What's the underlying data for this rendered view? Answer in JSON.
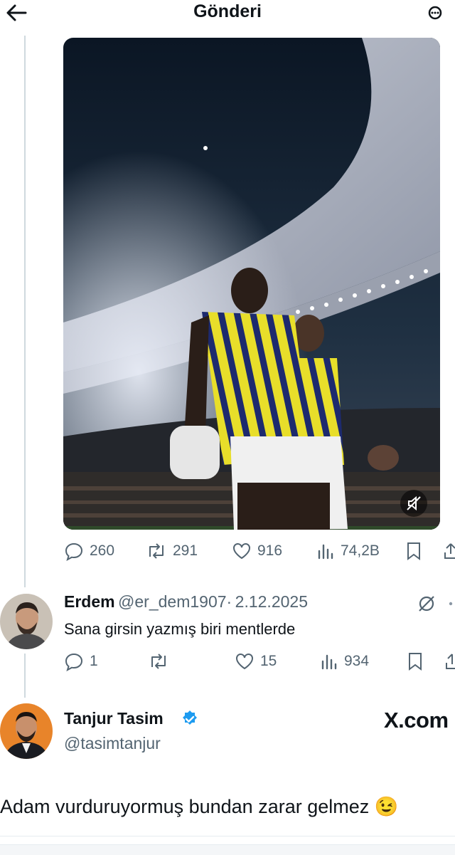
{
  "header": {
    "title": "Gönderi"
  },
  "original_tweet": {
    "actions": {
      "replies": "260",
      "retweets": "291",
      "likes": "916",
      "views": "74,2B"
    }
  },
  "reply": {
    "author_name": "Erdem",
    "author_handle": "@er_dem1907",
    "separator": "·",
    "date": "2.12.2025",
    "text": "Sana girsin yazmış biri mentlerde",
    "actions": {
      "replies": "1",
      "retweets": "",
      "likes": "15",
      "views": "934"
    }
  },
  "quoted_author": {
    "name": "Tanjur Tasim",
    "handle": "@tasimtanjur",
    "verified": true,
    "brand": "X.com"
  },
  "main_text": "Adam vurduruyormuş bundan zarar gelmez 😉",
  "colors": {
    "text": "#0f1419",
    "secondary": "#536471",
    "verified": "#1d9bf0",
    "thread_line": "#cfd9de"
  }
}
